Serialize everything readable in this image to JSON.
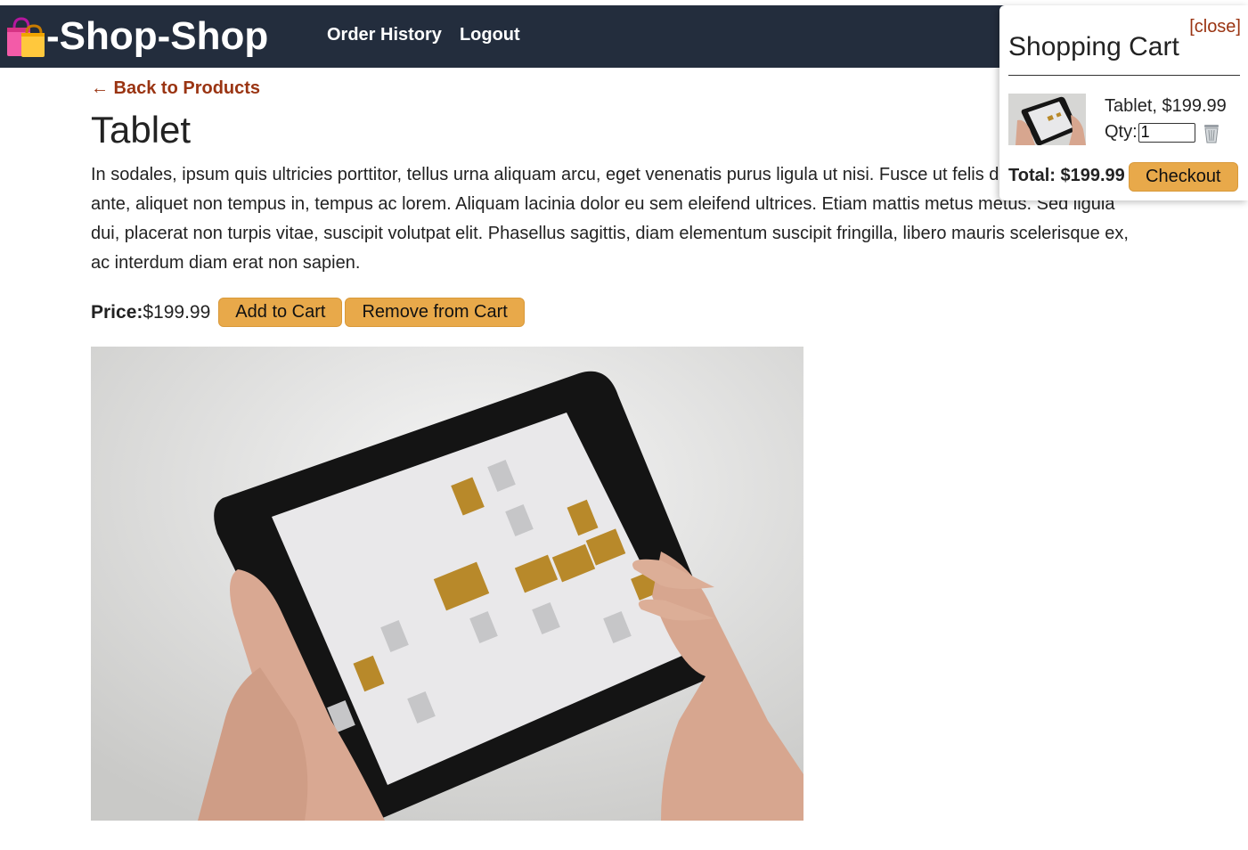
{
  "brand": {
    "name": "-Shop-Shop",
    "icon": "shopping-bags-icon"
  },
  "nav": {
    "links": [
      {
        "label": "Order History"
      },
      {
        "label": "Logout"
      }
    ]
  },
  "product": {
    "back_label": "← Back to Products",
    "title": "Tablet",
    "description": "In sodales, ipsum quis ultricies porttitor, tellus urna aliquam arcu, eget venenatis purus ligula ut nisi. Fusce ut felis dolor. Mauris justo ante, aliquet non tempus in, tempus ac lorem. Aliquam lacinia dolor eu sem eleifend ultrices. Etiam mattis metus metus. Sed ligula dui, placerat non turpis vitae, suscipit volutpat elit. Phasellus sagittis, diam elementum suscipit fringilla, libero mauris scelerisque ex, ac interdum diam erat non sapien.",
    "price_label": "Price:",
    "price_value": "$199.99",
    "add_label": "Add to Cart",
    "remove_label": "Remove from Cart",
    "image": "tablet-in-hands-photo"
  },
  "cart": {
    "close_label": "[close]",
    "title": "Shopping Cart",
    "items": [
      {
        "label": "Tablet, $199.99",
        "qty_label": "Qty:",
        "qty": "1"
      }
    ],
    "total_label": "Total: $199.99",
    "checkout_label": "Checkout"
  },
  "colors": {
    "navbar": "#232d3d",
    "accent": "#e8a94a",
    "link": "#9a3412"
  }
}
